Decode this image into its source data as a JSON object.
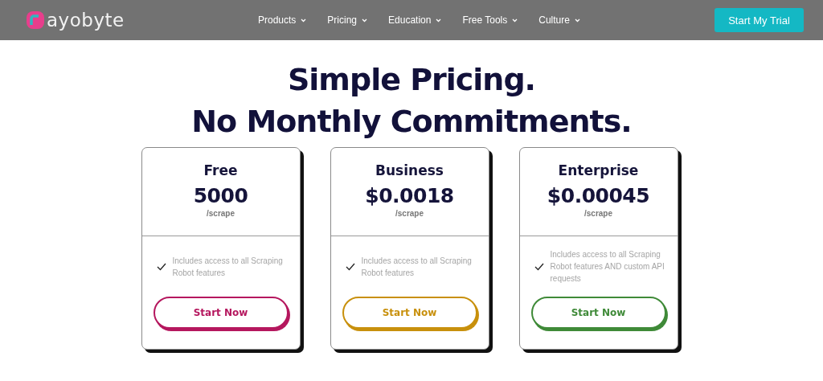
{
  "header": {
    "logo": "ayobyte",
    "nav": [
      {
        "label": "Products"
      },
      {
        "label": "Pricing"
      },
      {
        "label": "Education"
      },
      {
        "label": "Free Tools"
      },
      {
        "label": "Culture"
      }
    ],
    "cta": "Start My Trial"
  },
  "headline": [
    "Simple Pricing.",
    "No Monthly Commitments."
  ],
  "plans": [
    {
      "name": "Free",
      "price": "5000",
      "unit": "/scrape",
      "feature": "Includes access to all Scraping Robot features",
      "button": "Start Now",
      "color": "#b5175e"
    },
    {
      "name": "Business",
      "price": "$0.0018",
      "unit": "/scrape",
      "feature": "Includes access to all Scraping Robot features",
      "button": "Start Now",
      "color": "#c8900c"
    },
    {
      "name": "Enterprise",
      "price": "$0.00045",
      "unit": "/scrape",
      "feature": "Includes access to all Scraping Robot features AND custom API requests",
      "button": "Start Now",
      "color": "#3f8a38"
    }
  ]
}
